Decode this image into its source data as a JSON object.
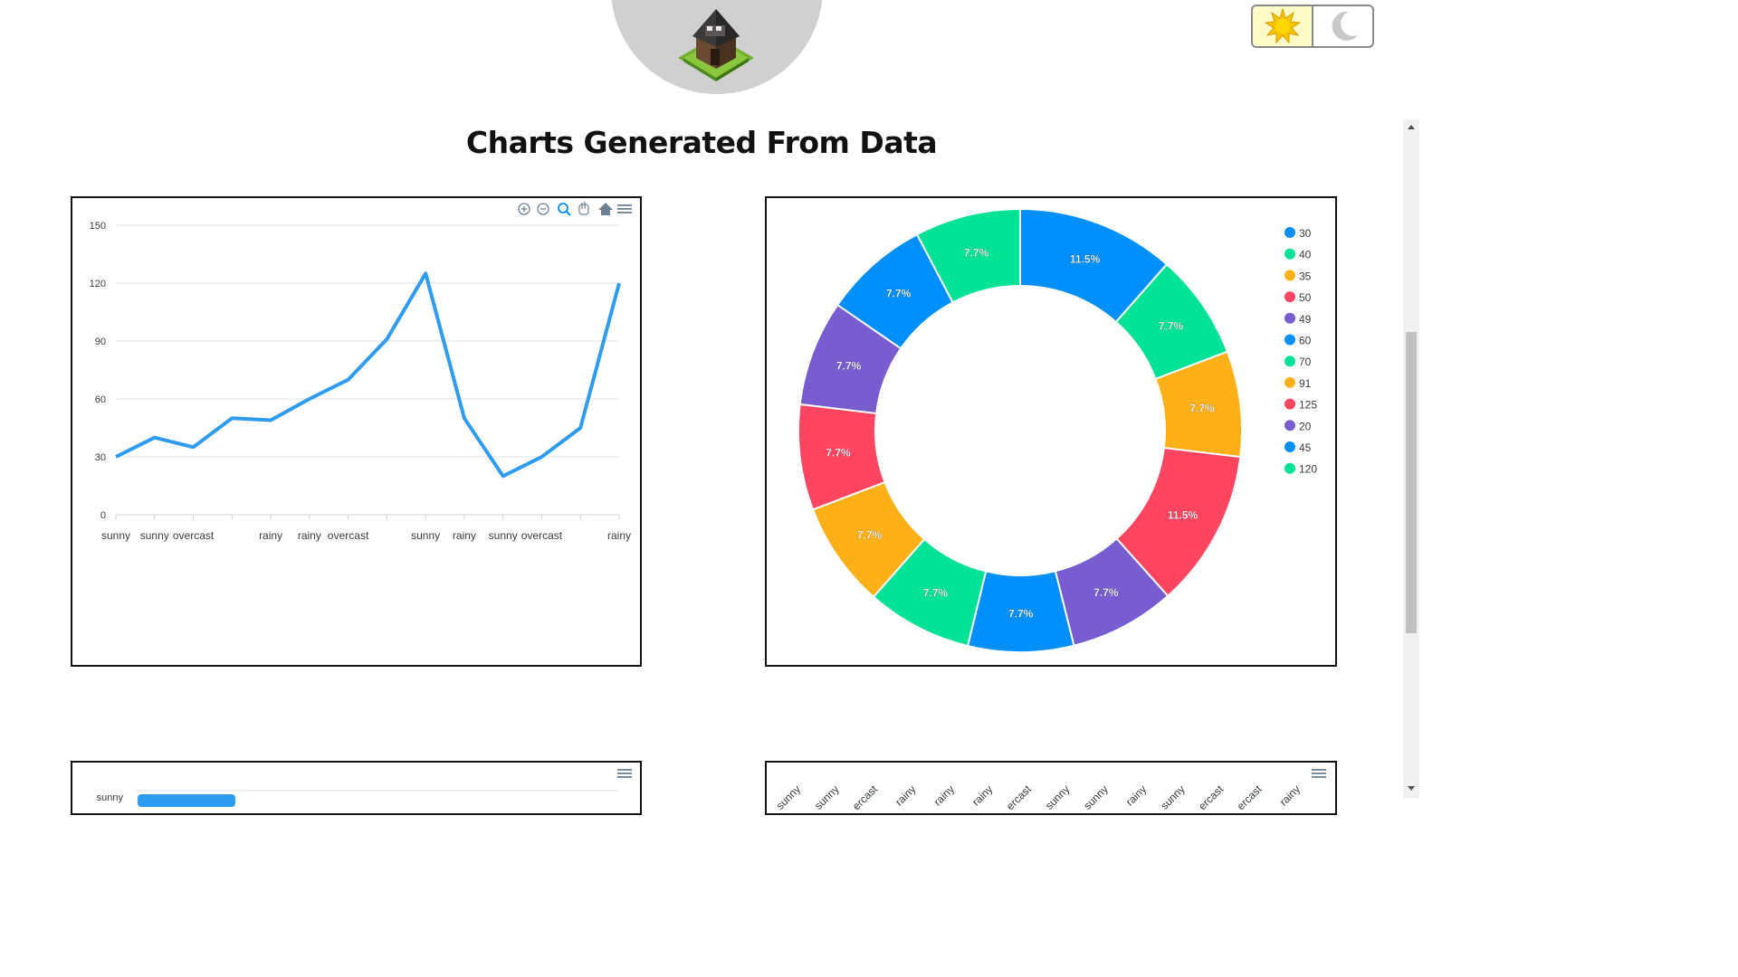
{
  "header": {
    "title": "Charts Generated From Data",
    "logo_icon": "clash-village-hut-icon",
    "theme_toggle": {
      "light_icon": "sun-icon",
      "dark_icon": "moon-icon",
      "active": "light"
    }
  },
  "colors": {
    "line_series": "#2e9cf0",
    "palette": [
      "#008ffb",
      "#00e396",
      "#feb019",
      "#ff4560",
      "#775dd0"
    ]
  },
  "toolbar_icons": [
    "zoom-in-icon",
    "zoom-out-icon",
    "zoom-selection-icon",
    "pan-hand-icon",
    "home-reset-icon",
    "menu-icon"
  ],
  "chart_data": [
    {
      "type": "line",
      "x": [
        "sunny",
        "sunny",
        "overcast",
        "",
        "rainy",
        "rainy",
        "overcast",
        "",
        "sunny",
        "rainy",
        "sunny",
        "overcast",
        "",
        "rainy"
      ],
      "values": [
        30,
        40,
        35,
        50,
        49,
        60,
        70,
        91,
        125,
        50,
        20,
        30,
        45,
        120
      ],
      "ylim": [
        0,
        150
      ],
      "yticks": [
        "0",
        "30",
        "60",
        "90",
        "120",
        "150"
      ],
      "grid": true
    },
    {
      "type": "pie",
      "variant": "donut",
      "labels": [
        "30",
        "40",
        "35",
        "50",
        "49",
        "60",
        "70",
        "91",
        "125",
        "20",
        "45",
        "120"
      ],
      "values": [
        11.5,
        7.7,
        7.7,
        11.5,
        7.7,
        7.7,
        7.7,
        7.7,
        7.7,
        7.7,
        7.7,
        7.7
      ],
      "slice_labels": [
        "11.5%",
        "7.7%",
        "7.7%",
        "11.5%",
        "7.7%",
        "7.7%",
        "7.7%",
        "7.7%",
        "7.7%",
        "7.7%",
        "7.7%",
        "7.7%"
      ],
      "legend_position": "top-right"
    },
    {
      "type": "bar",
      "orientation": "horizontal",
      "categories": [
        "sunny"
      ],
      "note": "partially visible"
    },
    {
      "type": "bar",
      "categories": [
        "sunny",
        "sunny",
        "overcast",
        "rainy",
        "rainy",
        "rainy",
        "overcast",
        "sunny",
        "sunny",
        "rainy",
        "sunny",
        "overcast",
        "overcast",
        "rainy"
      ],
      "tick_labels_visible": [
        "sunny",
        "sunny",
        "ercast",
        "rainy",
        "rainy",
        "rainy",
        "ercast",
        "sunny",
        "sunny",
        "rainy",
        "sunny",
        "ercast",
        "ercast",
        "rainy"
      ]
    }
  ]
}
